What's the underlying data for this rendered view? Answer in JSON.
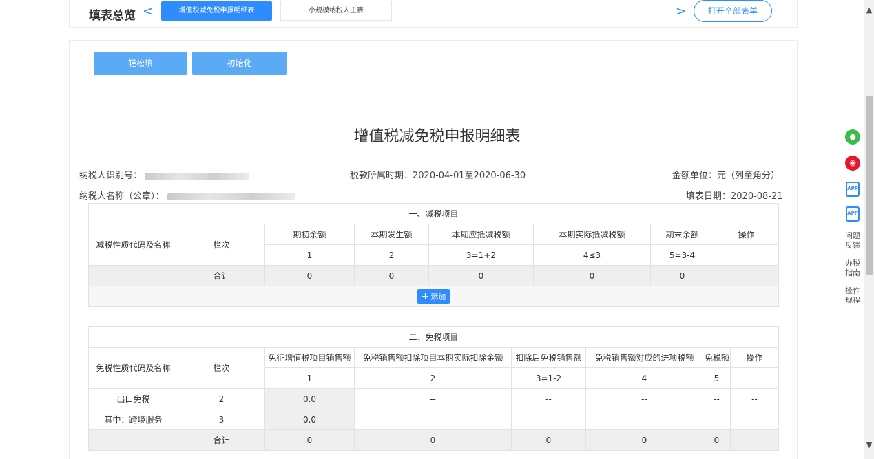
{
  "header": {
    "title": "填表总览",
    "nav_prev": "<",
    "nav_next": ">",
    "tabs": [
      {
        "label": "增值税减免税申报明细表",
        "active": true
      },
      {
        "label": "小规模纳税人主表",
        "active": false
      }
    ],
    "open_all": "打开全部表单"
  },
  "actions": {
    "easy_fill": "轻松填",
    "initialize": "初始化"
  },
  "form": {
    "title": "增值税减免税申报明细表",
    "taxpayer_id_label": "纳税人识别号：",
    "tax_period": "税款所属时期：2020-04-01至2020-06-30",
    "amount_unit": "金额单位：元（列至角分）",
    "taxpayer_name_label": "纳税人名称（公章）：",
    "fill_date": "填表日期：2020-08-21"
  },
  "section1": {
    "title": "一、减税项目",
    "col_code": "减税性质代码及名称",
    "col_row": "栏次",
    "headers": [
      "期初余额",
      "本期发生额",
      "本期应抵减税额",
      "本期实际抵减税额",
      "期末余额",
      "操作"
    ],
    "formulas": [
      "1",
      "2",
      "3=1+2",
      "4≤3",
      "5=3-4",
      ""
    ],
    "total_label": "合计",
    "totals": [
      "0",
      "0",
      "0",
      "0",
      "0",
      ""
    ],
    "add_label": "添加"
  },
  "section2": {
    "title": "二、免税项目",
    "col_code": "免税性质代码及名称",
    "col_row": "栏次",
    "headers": [
      "免征增值税项目销售额",
      "免税销售额扣除项目本期实际扣除金额",
      "扣除后免税销售额",
      "免税销售额对应的进项税额",
      "免税额",
      "操作"
    ],
    "formulas": [
      "1",
      "2",
      "3=1-2",
      "4",
      "5",
      ""
    ],
    "rows": [
      {
        "name": "出口免税",
        "row": "2",
        "cells": [
          "0.0",
          "--",
          "--",
          "--",
          "--",
          "--"
        ]
      },
      {
        "name": "其中：跨境服务",
        "row": "3",
        "cells": [
          "0.0",
          "--",
          "--",
          "--",
          "--",
          "--"
        ]
      }
    ],
    "total_label": "合计",
    "totals": [
      "0",
      "0",
      "0",
      "0",
      "0",
      ""
    ]
  },
  "sidebar": {
    "wechat_icon": "wechat-icon",
    "weibo_icon": "weibo-icon",
    "app1_label": "APP",
    "app2_label": "APP",
    "feedback": "问题反馈",
    "guide": "办税指南",
    "rules": "操作规程"
  },
  "colors": {
    "primary": "#2f8cff",
    "button": "#5aaaf5",
    "wechat": "#3dbb4a",
    "weibo": "#e6162d"
  }
}
